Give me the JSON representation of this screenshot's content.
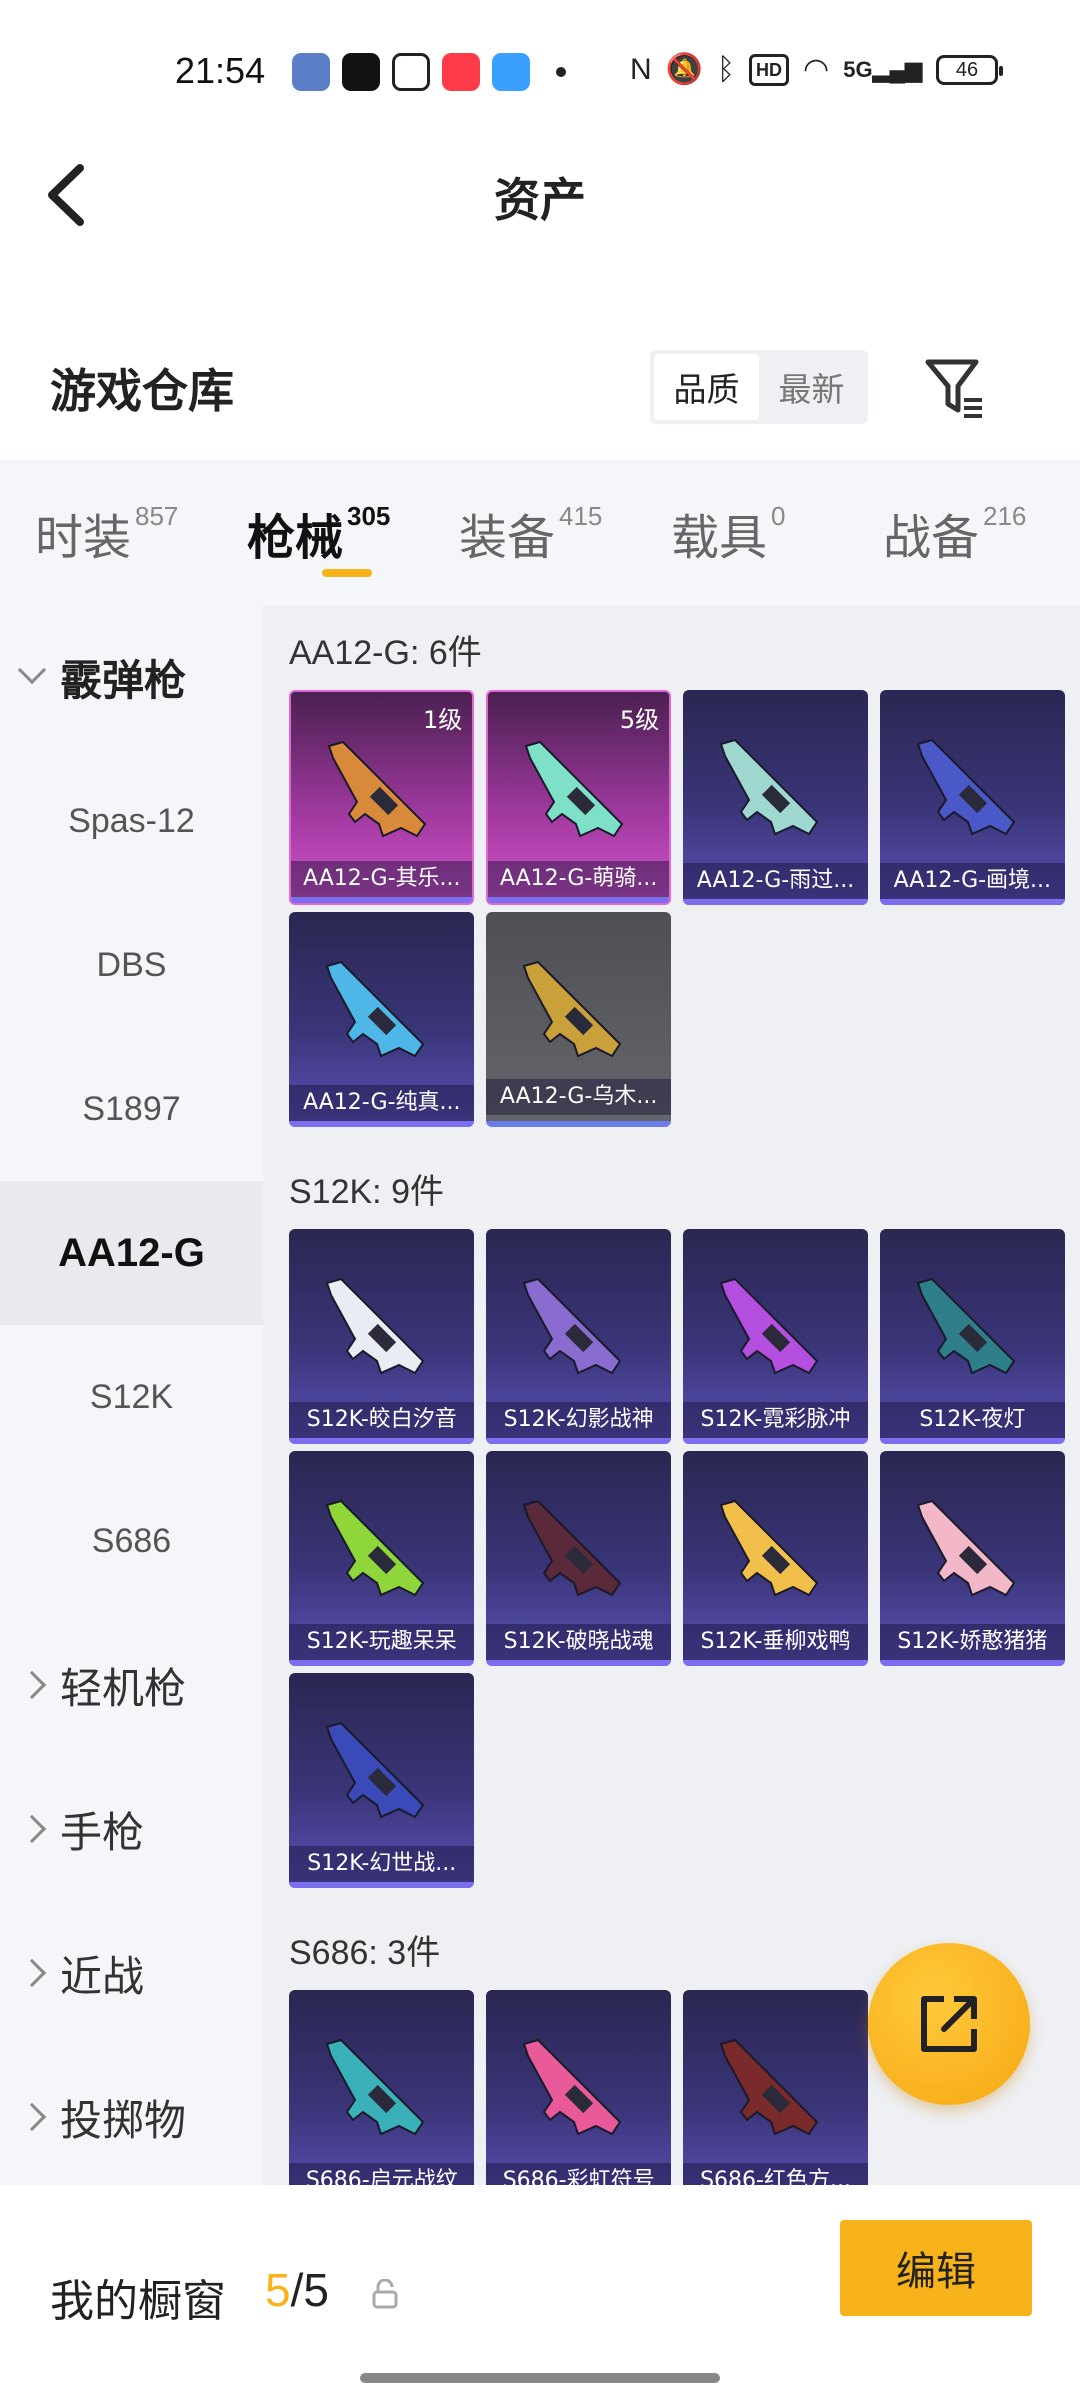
{
  "status_bar": {
    "time": "21:54",
    "network": "5G",
    "hd": "HD",
    "battery": "46",
    "app_colors": [
      "#5b7fc6",
      "#111111",
      "#ffffff",
      "#ff3b4a",
      "#3aa0ff"
    ]
  },
  "header": {
    "title": "资产"
  },
  "section": {
    "title": "游戏仓库",
    "sort_options": [
      "品质",
      "最新"
    ],
    "active_sort": "品质"
  },
  "tabs": [
    {
      "label": "时装",
      "count": "857"
    },
    {
      "label": "枪械",
      "count": "305"
    },
    {
      "label": "装备",
      "count": "415"
    },
    {
      "label": "载具",
      "count": "0"
    },
    {
      "label": "战备",
      "count": "216"
    }
  ],
  "active_tab": "枪械",
  "sidenav": [
    {
      "label": "霰弹枪",
      "type": "group",
      "state": "open"
    },
    {
      "label": "Spas-12",
      "type": "item"
    },
    {
      "label": "DBS",
      "type": "item"
    },
    {
      "label": "S1897",
      "type": "item"
    },
    {
      "label": "AA12-G",
      "type": "item",
      "active": true
    },
    {
      "label": "S12K",
      "type": "item"
    },
    {
      "label": "S686",
      "type": "item"
    },
    {
      "label": "轻机枪",
      "type": "group",
      "state": "closed"
    },
    {
      "label": "手枪",
      "type": "group",
      "state": "closed"
    },
    {
      "label": "近战",
      "type": "group",
      "state": "closed"
    },
    {
      "label": "投掷物",
      "type": "group",
      "state": "closed"
    }
  ],
  "groups": [
    {
      "title": "AA12-G: 6件",
      "items": [
        {
          "name": "AA12-G-其乐...",
          "level": "1级",
          "rarity": "pink",
          "gun_color": "#d88a3a"
        },
        {
          "name": "AA12-G-萌骑...",
          "level": "5级",
          "rarity": "pink",
          "gun_color": "#7fe0c8"
        },
        {
          "name": "AA12-G-雨过...",
          "level": "",
          "rarity": "purple",
          "gun_color": "#9ed8d0"
        },
        {
          "name": "AA12-G-画境...",
          "level": "",
          "rarity": "purple",
          "gun_color": "#4a58c8"
        },
        {
          "name": "AA12-G-纯真...",
          "level": "",
          "rarity": "purple",
          "gun_color": "#4fb7e8"
        },
        {
          "name": "AA12-G-乌木...",
          "level": "",
          "rarity": "gray",
          "gun_color": "#c9a03a"
        }
      ]
    },
    {
      "title": "S12K: 9件",
      "items": [
        {
          "name": "S12K-皎白汐音",
          "level": "",
          "rarity": "purple",
          "gun_color": "#e9ecf2"
        },
        {
          "name": "S12K-幻影战神",
          "level": "",
          "rarity": "purple",
          "gun_color": "#8a6cd0"
        },
        {
          "name": "S12K-霓彩脉冲",
          "level": "",
          "rarity": "purple",
          "gun_color": "#b54fe0"
        },
        {
          "name": "S12K-夜灯",
          "level": "",
          "rarity": "purple",
          "gun_color": "#2f7f8a"
        },
        {
          "name": "S12K-玩趣呆呆",
          "level": "",
          "rarity": "purple",
          "gun_color": "#8ed63a"
        },
        {
          "name": "S12K-破晓战魂",
          "level": "",
          "rarity": "purple",
          "gun_color": "#5a2a3a"
        },
        {
          "name": "S12K-垂柳戏鸭",
          "level": "",
          "rarity": "purple",
          "gun_color": "#f2c04a"
        },
        {
          "name": "S12K-娇憨猪猪",
          "level": "",
          "rarity": "purple",
          "gun_color": "#f2b8c8"
        },
        {
          "name": "S12K-幻世战...",
          "level": "",
          "rarity": "purple",
          "gun_color": "#3a4ab8"
        }
      ]
    },
    {
      "title": "S686: 3件",
      "items": [
        {
          "name": "S686-启元战纹",
          "level": "",
          "rarity": "purple",
          "gun_color": "#3ab0b8"
        },
        {
          "name": "S686-彩虹符号",
          "level": "",
          "rarity": "purple",
          "gun_color": "#e85a9a"
        },
        {
          "name": "S686-红色方...",
          "level": "",
          "rarity": "purple",
          "gun_color": "#7a2a2a"
        }
      ]
    }
  ],
  "bottom_bar": {
    "showcase_label": "我的橱窗",
    "count_current": "5",
    "count_separator": "/",
    "count_max": "5",
    "edit_label": "编辑"
  },
  "colors": {
    "accent": "#f7b319",
    "rarity_pink": "#d156c9",
    "rarity_purple": "#5b52b8",
    "rarity_gray": "#65666c"
  }
}
